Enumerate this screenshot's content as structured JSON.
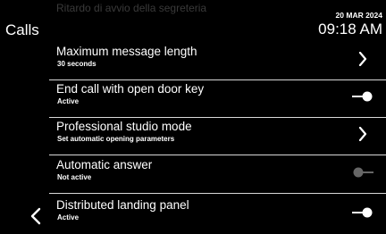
{
  "header": {
    "title": "Calls",
    "ghost_text": "Ritardo di avvio della segreteria",
    "date": "20 MAR 2024",
    "time": "09:18 AM"
  },
  "rows": [
    {
      "label": "Maximum message length",
      "sub": "30 seconds",
      "control": "chevron-right"
    },
    {
      "label": "End call with open door key",
      "sub": "Active",
      "control": "toggle-on"
    },
    {
      "label": "Professional studio mode",
      "sub": "Set automatic opening parameters",
      "control": "chevron-right"
    },
    {
      "label": "Automatic answer",
      "sub": "Not active",
      "control": "toggle-off"
    },
    {
      "label": "Distributed landing panel",
      "sub": "Active",
      "control": "toggle-on"
    }
  ],
  "colors": {
    "background": "#000000",
    "text": "#ffffff",
    "toggle_off": "#666666",
    "separator": "#d8d8d8"
  }
}
